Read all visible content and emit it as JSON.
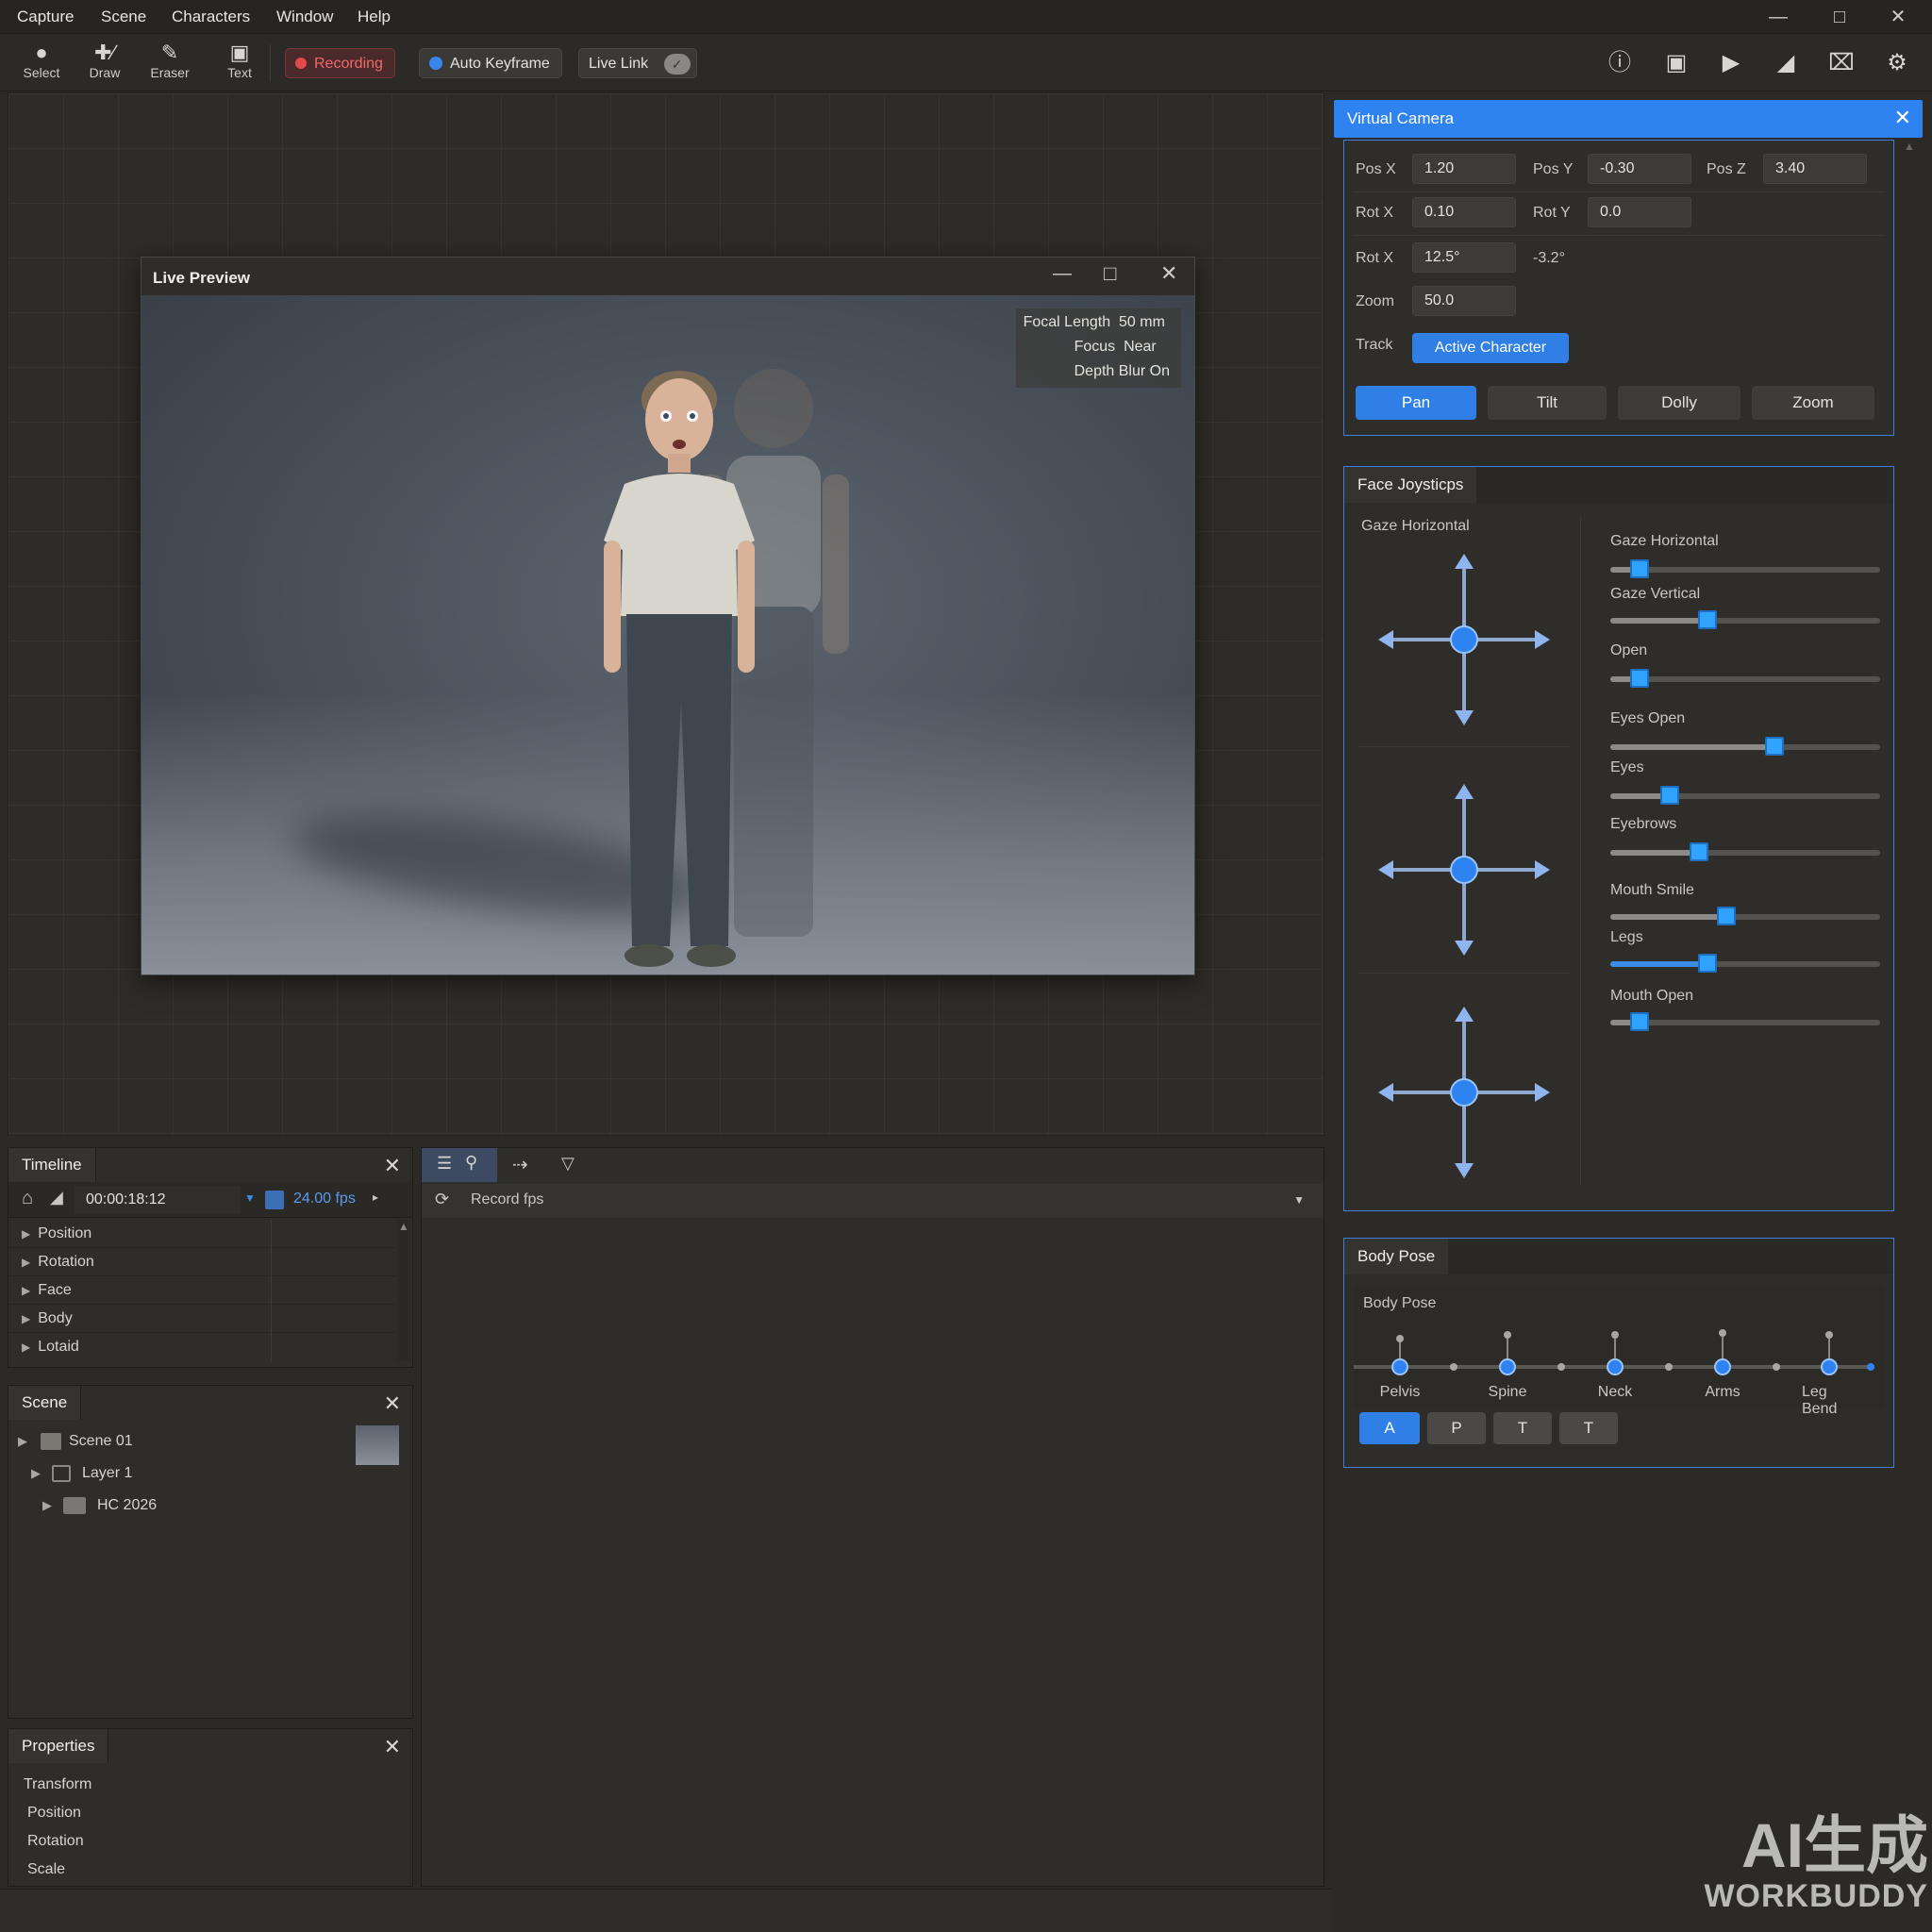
{
  "menubar": {
    "items": [
      "Capture",
      "Scene",
      "Characters",
      "Window",
      "Help"
    ],
    "window_controls": [
      "minimize-icon",
      "maximize-icon",
      "close-icon"
    ]
  },
  "toolbar": {
    "tools": [
      {
        "label": "Select",
        "icon": "select-icon"
      },
      {
        "label": "Draw",
        "icon": "draw-icon"
      },
      {
        "label": "Eraser",
        "icon": "eraser-icon"
      },
      {
        "label": "Text",
        "icon": "text-icon"
      }
    ],
    "recording_label": "Recording",
    "auto_keyframe_label": "Auto Keyframe",
    "live_link_label": "Live Link",
    "right_icons": [
      "info-icon",
      "briefcase-icon",
      "play-icon",
      "image-icon",
      "crop-icon",
      "settings-icon"
    ]
  },
  "preview": {
    "title": "Live Preview",
    "hud": {
      "focal_length_label": "Focal Length",
      "focal_length_value": "50 mm",
      "focus_label": "Focus",
      "focus_value": "Near",
      "depth_blur_label": "Depth Blur",
      "depth_blur_value": "On"
    }
  },
  "timeline": {
    "title": "Timeline",
    "timecode": "00:00:18:12",
    "fps": "24.00 fps",
    "tracks": [
      "Position",
      "Rotation",
      "Face",
      "Body",
      "Lotaid"
    ]
  },
  "record_panel": {
    "dropdown_label": "Record fps"
  },
  "scene": {
    "title": "Scene",
    "items": [
      {
        "label": "Scene 01",
        "level": 0
      },
      {
        "label": "Layer 1",
        "level": 1
      },
      {
        "label": "HC 2026",
        "level": 2
      }
    ]
  },
  "properties": {
    "title": "Properties",
    "items": [
      "Transform",
      "Position",
      "Rotation",
      "Scale"
    ]
  },
  "virtual_camera": {
    "title": "Virtual Camera",
    "pos_x_label": "Pos X",
    "pos_x": "1.20",
    "pos_y_label": "Pos Y",
    "pos_y": "-0.30",
    "pos_z_label": "Pos Z",
    "pos_z": "3.40",
    "rot_x_label": "Rot X",
    "rot_x": "0.10",
    "rot_y_label": "Rot Y",
    "rot_y": "0.0",
    "rot_x2_label": "Rot X",
    "rot_x2": "12.5°",
    "rot_extra": "-3.2°",
    "zoom_label": "Zoom",
    "zoom": "50.0",
    "track_label": "Track",
    "track_value": "Active Character",
    "modes": [
      "Pan",
      "Tilt",
      "Dolly",
      "Zoom"
    ],
    "active_mode": "Pan"
  },
  "face_joysticks": {
    "title": "Face Joysticps",
    "joystick_label": "Gaze Horizontal",
    "sliders": [
      {
        "label": "Gaze Horizontal",
        "value": 0.11,
        "blue": false
      },
      {
        "label": "Gaze Vertical",
        "value": 0.36,
        "blue": false
      },
      {
        "label": "Open",
        "value": 0.11,
        "blue": false
      },
      {
        "label": "Eyes Open",
        "value": 0.61,
        "blue": false
      },
      {
        "label": "Eyes",
        "value": 0.22,
        "blue": false
      },
      {
        "label": "Eyebrows",
        "value": 0.33,
        "blue": false
      },
      {
        "label": "Mouth Smile",
        "value": 0.43,
        "blue": false
      },
      {
        "label": "Legs",
        "value": 0.36,
        "blue": true
      },
      {
        "label": "Mouth Open",
        "value": 0.11,
        "blue": false
      }
    ]
  },
  "body_pose": {
    "title": "Body Pose",
    "subtitle": "Body Pose",
    "joints": [
      "Pelvis",
      "Spine",
      "Neck",
      "Arms",
      "Leg Bend"
    ],
    "buttons": [
      "A",
      "P",
      "T",
      "T"
    ],
    "active_button": "A"
  },
  "watermark": {
    "line1": "AI生成",
    "line2": "WORKBUDDY"
  },
  "colors": {
    "accent": "#2f7fe6",
    "recording": "#e14b4b",
    "panel": "#2e2d2a",
    "background": "#2b2a27"
  }
}
